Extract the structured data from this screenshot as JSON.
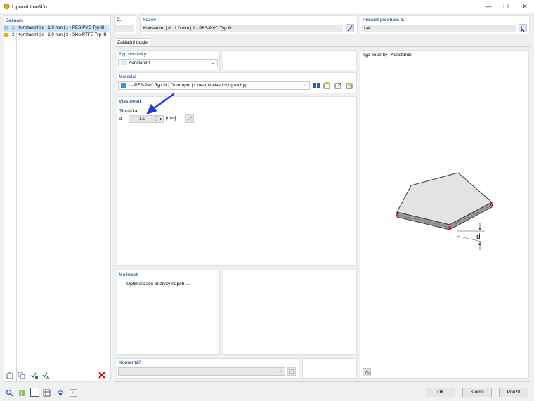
{
  "window": {
    "title": "Upravit tloušťku"
  },
  "list": {
    "header": "Seznam",
    "items": [
      {
        "no": "1",
        "label": "Konstantní | d : 1.0 mm | 1 - PES-PVC Typ III",
        "color": "#8cc6ee"
      },
      {
        "no": "2",
        "label": "Konstantní | d : 1.0 mm | 2 - Sklo-PTFE Typ III",
        "color": "#f2b400"
      }
    ]
  },
  "header": {
    "no_label": "Č.",
    "no_value": "1",
    "name_label": "Název",
    "name_value": "Konstantní | d : 1.0 mm | 1 - PES-PVC Typ III",
    "assign_label": "Přiřadit plochám č.",
    "assign_value": "1-4"
  },
  "tabs": [
    {
      "label": "Základní údaje"
    }
  ],
  "thickness_type": {
    "header": "Typ tloušťky",
    "value": "Konstantní"
  },
  "material": {
    "header": "Materiál",
    "value": "1 - PES-PVC Typ III | Ortotropní | Lineárně elastický (plochy)",
    "color": "#3d8fd8"
  },
  "properties": {
    "header": "Vlastnosti",
    "group": "Tloušťka",
    "symbol": "d",
    "value": "1.0",
    "unit": "[mm]"
  },
  "options": {
    "header": "Možnosti",
    "checkbox_label": "Optimalizace analýzy napětí ...",
    "checked": false
  },
  "comment": {
    "header": "Komentář",
    "value": ""
  },
  "preview": {
    "type_label": "Typ tloušťky",
    "type_value": "Konstantní",
    "dim_label": "d"
  },
  "footer": {
    "ok": "OK",
    "cancel": "Storno",
    "apply": "Použít"
  },
  "accent": "#3a6aa0"
}
